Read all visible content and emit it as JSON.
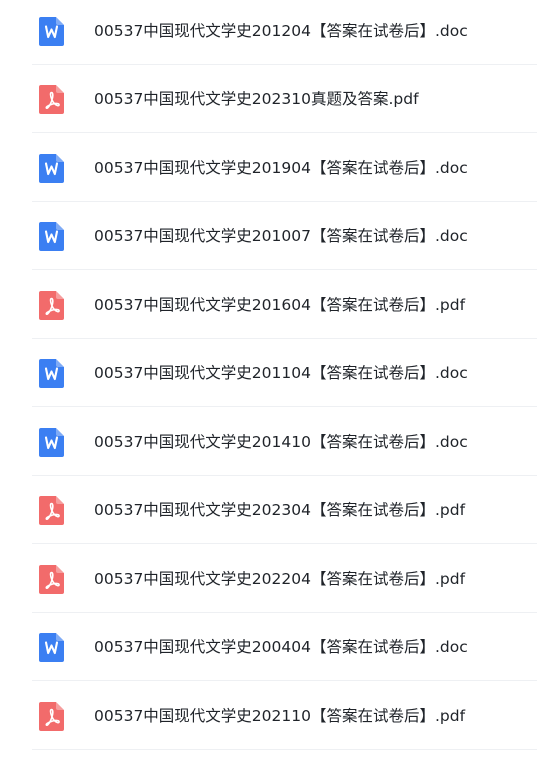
{
  "files": [
    {
      "name": "00537中国现代文学史201204【答案在试卷后】.doc",
      "icon": "word-icon",
      "icon_color": "#3b7ff2"
    },
    {
      "name": "00537中国现代文学史202310真题及答案.pdf",
      "icon": "pdf-icon",
      "icon_color": "#f26b6b"
    },
    {
      "name": "00537中国现代文学史201904【答案在试卷后】.doc",
      "icon": "word-icon",
      "icon_color": "#3b7ff2"
    },
    {
      "name": "00537中国现代文学史201007【答案在试卷后】.doc",
      "icon": "word-icon",
      "icon_color": "#3b7ff2"
    },
    {
      "name": "00537中国现代文学史201604【答案在试卷后】.pdf",
      "icon": "pdf-icon",
      "icon_color": "#f26b6b"
    },
    {
      "name": "00537中国现代文学史201104【答案在试卷后】.doc",
      "icon": "word-icon",
      "icon_color": "#3b7ff2"
    },
    {
      "name": "00537中国现代文学史201410【答案在试卷后】.doc",
      "icon": "word-icon",
      "icon_color": "#3b7ff2"
    },
    {
      "name": "00537中国现代文学史202304【答案在试卷后】.pdf",
      "icon": "pdf-icon",
      "icon_color": "#f26b6b"
    },
    {
      "name": "00537中国现代文学史202204【答案在试卷后】.pdf",
      "icon": "pdf-icon",
      "icon_color": "#f26b6b"
    },
    {
      "name": "00537中国现代文学史200404【答案在试卷后】.doc",
      "icon": "word-icon",
      "icon_color": "#3b7ff2"
    },
    {
      "name": "00537中国现代文学史202110【答案在试卷后】.pdf",
      "icon": "pdf-icon",
      "icon_color": "#f26b6b"
    }
  ]
}
